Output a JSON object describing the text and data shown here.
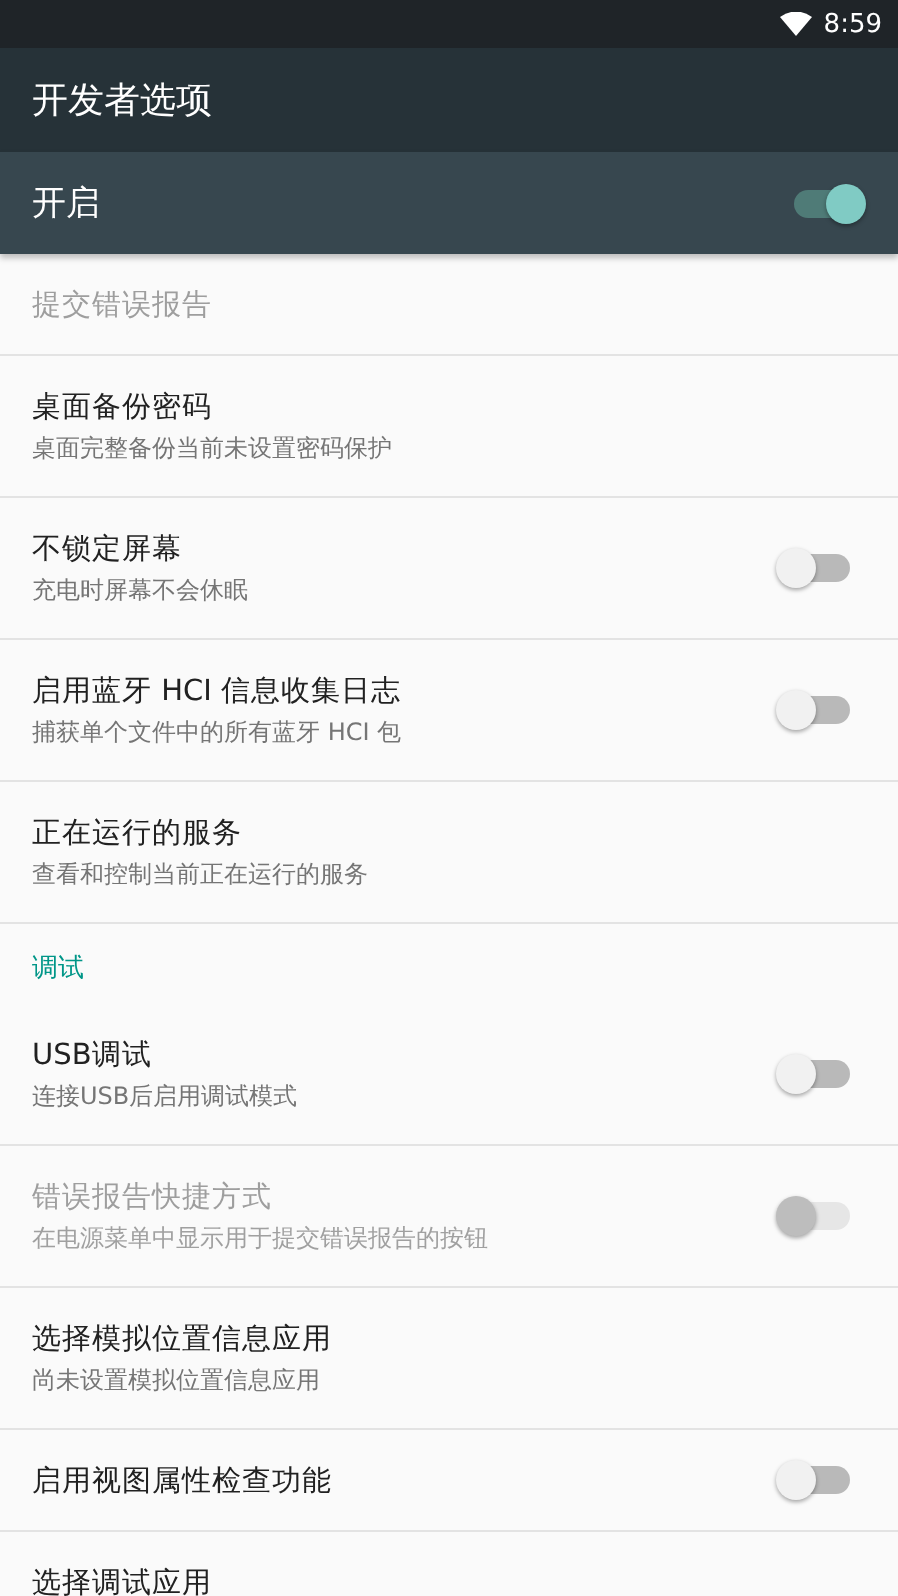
{
  "status_bar": {
    "time": "8:59"
  },
  "toolbar": {
    "title": "开发者选项"
  },
  "master_switch": {
    "label": "开启",
    "on": true
  },
  "sections": [
    {
      "items": [
        {
          "kind": "plain",
          "title": "提交错误报告",
          "disabled": true
        },
        {
          "kind": "plain",
          "title": "桌面备份密码",
          "summary": "桌面完整备份当前未设置密码保护",
          "disabled": false
        },
        {
          "kind": "switch",
          "title": "不锁定屏幕",
          "summary": "充电时屏幕不会休眠",
          "disabled": false,
          "on": false
        },
        {
          "kind": "switch",
          "title": "启用蓝牙 HCI 信息收集日志",
          "summary": "捕获单个文件中的所有蓝牙 HCI 包",
          "disabled": false,
          "on": false
        },
        {
          "kind": "plain",
          "title": "正在运行的服务",
          "summary": "查看和控制当前正在运行的服务",
          "disabled": false
        }
      ]
    },
    {
      "header": "调试",
      "items": [
        {
          "kind": "switch",
          "title": "USB调试",
          "summary": "连接USB后启用调试模式",
          "disabled": false,
          "on": false
        },
        {
          "kind": "switch",
          "title": "错误报告快捷方式",
          "summary": "在电源菜单中显示用于提交错误报告的按钮",
          "disabled": true,
          "on": false
        },
        {
          "kind": "plain",
          "title": "选择模拟位置信息应用",
          "summary": "尚未设置模拟位置信息应用",
          "disabled": false
        },
        {
          "kind": "switch",
          "title": "启用视图属性检查功能",
          "disabled": false,
          "on": false
        },
        {
          "kind": "plain",
          "title": "选择调试应用",
          "disabled": false
        }
      ]
    }
  ]
}
